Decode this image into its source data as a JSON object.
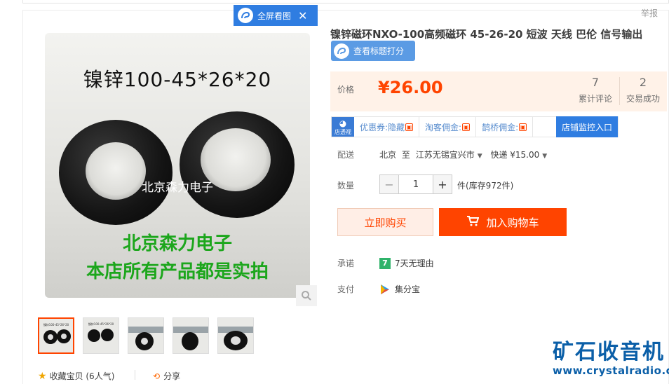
{
  "overlay": {
    "fullscreen_label": "全屏看图"
  },
  "report_label": "举报",
  "product": {
    "title": "镍锌磁环NXO-100高频磁环 45-26-20 短波 天线 巴伦 信号输出",
    "check_title_label": "查看标题打分",
    "image": {
      "title_text": "镍锌100-45*26*20",
      "watermark": "北京森力电子",
      "green_line1": "北京森力电子",
      "green_line2": "本店所有产品都是实拍"
    },
    "thumb_caption": "镍锌100-45*26*20",
    "price_label": "价格",
    "price": "¥26.00",
    "reviews_count": "7",
    "reviews_label": "累计评论",
    "sales_count": "2",
    "sales_label": "交易成功"
  },
  "promo": {
    "logo_label": "店透视",
    "coupon": "优惠券:隐藏",
    "taoke": "淘客佣金:",
    "queqiao": "鹊桥佣金:",
    "lock": "🔒",
    "monitor": "店铺监控入口"
  },
  "shipping": {
    "label": "配送",
    "from": "北京",
    "to_word": "至",
    "dest": "江苏无锡宜兴市",
    "method": "快递 ¥15.00"
  },
  "quantity": {
    "label": "数量",
    "value": "1",
    "stock": "件(库存972件)"
  },
  "actions": {
    "buy_now": "立即购买",
    "add_cart": "加入购物车"
  },
  "promise": {
    "label": "承诺",
    "icon_text": "7",
    "text": "7天无理由"
  },
  "payment": {
    "label": "支付",
    "text": "集分宝"
  },
  "favorite": {
    "text": "收藏宝贝 (6人气)"
  },
  "share": {
    "text": "分享"
  },
  "watermark": {
    "logo": "矿石收音机",
    "url": "www.crystalradio.cn"
  },
  "colors": {
    "accent": "#ff4400",
    "blue": "#2f7de1",
    "green_text": "#1ca61c",
    "watermark": "#0b5fa8"
  }
}
